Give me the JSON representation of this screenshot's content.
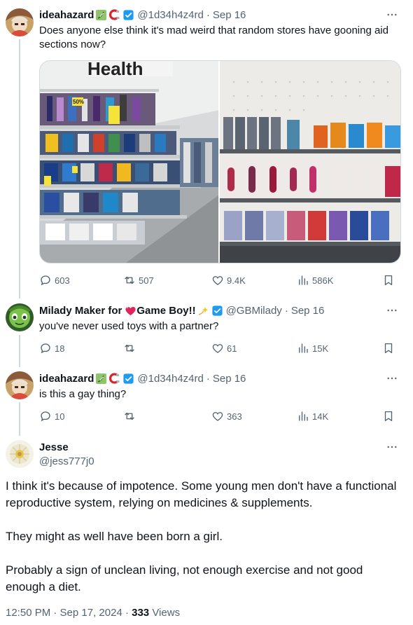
{
  "tweets": [
    {
      "name": "ideahazard",
      "handle": "@1d34h4z4rd",
      "time": "Sep 16",
      "text": "Does anyone else think it's mad weird that random stores have gooning aid sections now?",
      "replies": "603",
      "retweets": "507",
      "likes": "9.4K",
      "views": "586K",
      "photos": [
        {
          "sign": "Health",
          "tag": "50%"
        },
        {
          "sign": "",
          "tag": ""
        }
      ]
    },
    {
      "name": "Milady Maker for",
      "name_suffix": "Game Boy!!",
      "handle": "@GBMilady",
      "time": "Sep 16",
      "text": "you've never used toys with a partner?",
      "replies": "18",
      "retweets": "",
      "likes": "61",
      "views": "15K"
    },
    {
      "name": "ideahazard",
      "handle": "@1d34h4z4rd",
      "time": "Sep 16",
      "text": "is this a gay thing?",
      "replies": "10",
      "retweets": "",
      "likes": "363",
      "views": "14K"
    }
  ],
  "main": {
    "name": "Jesse",
    "handle": "@jess777j0",
    "paragraphs": [
      "I think it's because of impotence. Some young men don't have a functional reproductive system, relying on medicines & supplements.",
      "They might as well have been born a girl.",
      "Probably a sign of unclean living, not enough exercise and not good enough a diet."
    ],
    "timestamp": "12:50 PM · Sep 17, 2024 · ",
    "views_count": "333",
    "views_label": " Views"
  },
  "separator": "·",
  "icons": {
    "reply": "reply-icon",
    "retweet": "retweet-icon",
    "like": "heart-icon",
    "views": "views-icon",
    "bookmark": "bookmark-icon",
    "verified": "verified-badge-icon",
    "more": "more-icon"
  },
  "colors": {
    "text": "#0f1419",
    "secondary": "#536471",
    "verified": "#1d9bf0",
    "line": "#cfd9de"
  }
}
